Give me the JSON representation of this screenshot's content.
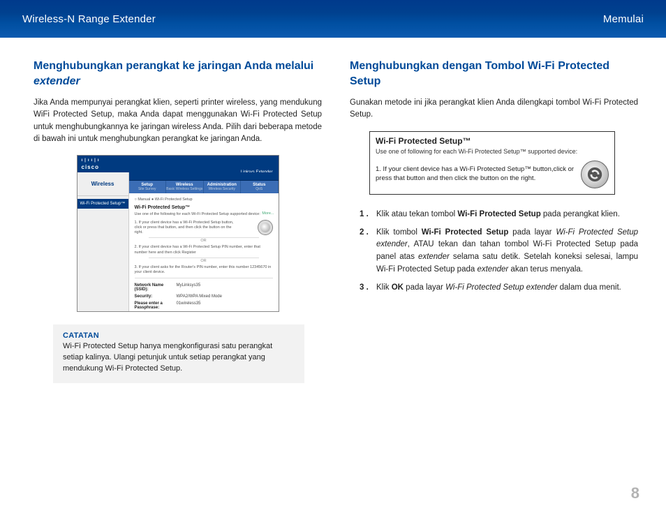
{
  "header": {
    "left": "Wireless-N Range Extender",
    "right": "Memulai"
  },
  "left": {
    "heading_a": "Menghubungkan perangkat ke jaringan Anda melalui ",
    "heading_em": "extender",
    "para": "Jika Anda mempunyai perangkat klien, seperti printer wireless, yang mendukung WiFi Protected Setup, maka Anda dapat menggunakan Wi-Fi Protected Setup untuk menghubungkannya ke jaringan wireless Anda. Pilih dari beberapa metode di bawah ini untuk menghubungkan perangkat ke jaringan Anda.",
    "router": {
      "brand": "cisco",
      "side_title": "Wireless",
      "side_tab": "Wi-Fi Protected Setup™",
      "linksys": "Linksys Extender",
      "tabs": [
        {
          "t1": "Setup",
          "t2": "Site Survey"
        },
        {
          "t1": "Wireless",
          "t2": "Basic Wireless Settings"
        },
        {
          "t1": "Administration",
          "t2": "Wireless Security"
        },
        {
          "t1": "Status",
          "t2": "QoS"
        }
      ],
      "manual": "○ Manual  ● Wi-Fi Protected Setup",
      "panel_h": "Wi-Fi Protected Setup™",
      "panel_sub": "Use one of the following for each Wi-Fi Protected Setup supported device:",
      "step1": "1. If your client device has a Wi-Fi Protected Setup button, click or press that button, and then click the button on the right.",
      "or": "OR",
      "step2": "2. If your client device has a Wi-Fi Protected Setup PIN number, enter that number here and then click  Register",
      "step3": "3. If your client asks for the Router's PIN number, enter this number 12345670 in your client device.",
      "rows": [
        {
          "k": "Network Name (SSID):",
          "v": "MyLinksys35"
        },
        {
          "k": "Security:",
          "v": "WPA2/WPA Mixed Mode"
        },
        {
          "k": "Please enter a Passphrase:",
          "v": "01wireless35"
        }
      ],
      "more": "More..."
    },
    "note_h": "CATATAN",
    "note_b": "Wi-Fi Protected Setup hanya mengkonfigurasi satu perangkat setiap kalinya. Ulangi petunjuk untuk setiap perangkat yang mendukung Wi-Fi Protected Setup."
  },
  "right": {
    "heading": "Menghubungkan dengan Tombol Wi-Fi Protected Setup",
    "para": "Gunakan metode ini jika perangkat klien Anda dilengkapi tombol Wi-Fi Protected Setup.",
    "wps_title": "Wi-Fi Protected Setup™",
    "wps_sub": "Use one of following for each Wi-Fi Protected Setup™ supported device:",
    "wps_text": "1. If your client device has a Wi-Fi Protected Setup™ button,click or press that button and then click the button on the right.",
    "steps": {
      "s1a": "Klik atau tekan tombol ",
      "s1b": "Wi-Fi Protected Setup",
      "s1c": " pada perangkat klien.",
      "s2a": "Klik tombol ",
      "s2b": "Wi-Fi Protected Setup",
      "s2c": " pada layar ",
      "s2d": "Wi-Fi Protected Setup extender",
      "s2e": ", ATAU tekan dan tahan tombol Wi-Fi Protected Setup pada panel atas ",
      "s2f": "extender",
      "s2g": " selama satu detik. Setelah koneksi selesai, lampu Wi-Fi Protected Setup pada ",
      "s2h": "extender",
      "s2i": " akan terus menyala.",
      "s3a": "Klik ",
      "s3b": "OK",
      "s3c": " pada layar ",
      "s3d": "Wi-Fi Protected Setup extender",
      "s3e": " dalam dua menit."
    }
  },
  "page_number": "8"
}
